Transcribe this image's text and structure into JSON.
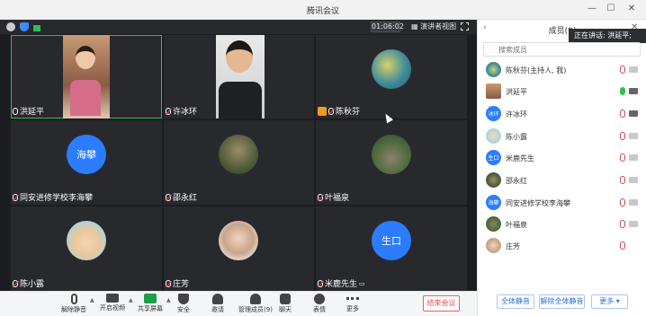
{
  "window": {
    "title": "腾讯会议"
  },
  "infobar": {
    "time": "01:06:02",
    "view_label": "演讲者视图"
  },
  "tiles": [
    {
      "name": "洪延平",
      "muted": false
    },
    {
      "name": "许冰环",
      "muted": true
    },
    {
      "name": "陈秋芬",
      "muted": true
    },
    {
      "name": "同安进修学校李海攀",
      "avatar_text": "海攀",
      "muted": true
    },
    {
      "name": "邵永红",
      "muted": true
    },
    {
      "name": "叶福泉",
      "muted": true
    },
    {
      "name": "陈小露",
      "muted": true
    },
    {
      "name": "庄芳",
      "muted": true
    },
    {
      "name": "米鹿先生",
      "avatar_text": "生口",
      "muted": true
    }
  ],
  "toolbar": {
    "unmute": "解除静音",
    "video": "开启视频",
    "share": "共享屏幕",
    "security": "安全",
    "invite": "邀请",
    "members": "管理成员(9)",
    "chat": "聊天",
    "reaction": "表情",
    "more": "更多",
    "end": "结束会议"
  },
  "panel": {
    "title": "成员(9)",
    "speaking": "正在讲话: 洪延平;",
    "search_placeholder": "搜索成员",
    "members": [
      {
        "name": "陈秋芬(主持人, 我)",
        "mic_on": false,
        "cam_on": false
      },
      {
        "name": "洪延平",
        "mic_on": true,
        "cam_on": true
      },
      {
        "name": "许冰环",
        "avatar_text": "冰环",
        "mic_on": false,
        "cam_on": true
      },
      {
        "name": "陈小露",
        "mic_on": false,
        "cam_on": false
      },
      {
        "name": "米鹿先生",
        "avatar_text": "生口",
        "mic_on": false,
        "cam_on": false
      },
      {
        "name": "邵永红",
        "mic_on": false,
        "cam_on": false
      },
      {
        "name": "同安进修学校李海攀",
        "avatar_text": "海攀",
        "mic_on": false,
        "cam_on": false
      },
      {
        "name": "叶福泉",
        "mic_on": false,
        "cam_on": false
      },
      {
        "name": "庄芳",
        "mic_on": false,
        "cam_on": false
      }
    ],
    "mute_all": "全体静音",
    "unmute_all": "解除全体静音",
    "more": "更多 ▾"
  },
  "colors": {
    "accent": "#2b7cff",
    "active_border": "#2fbf53",
    "end": "#e5484d"
  }
}
